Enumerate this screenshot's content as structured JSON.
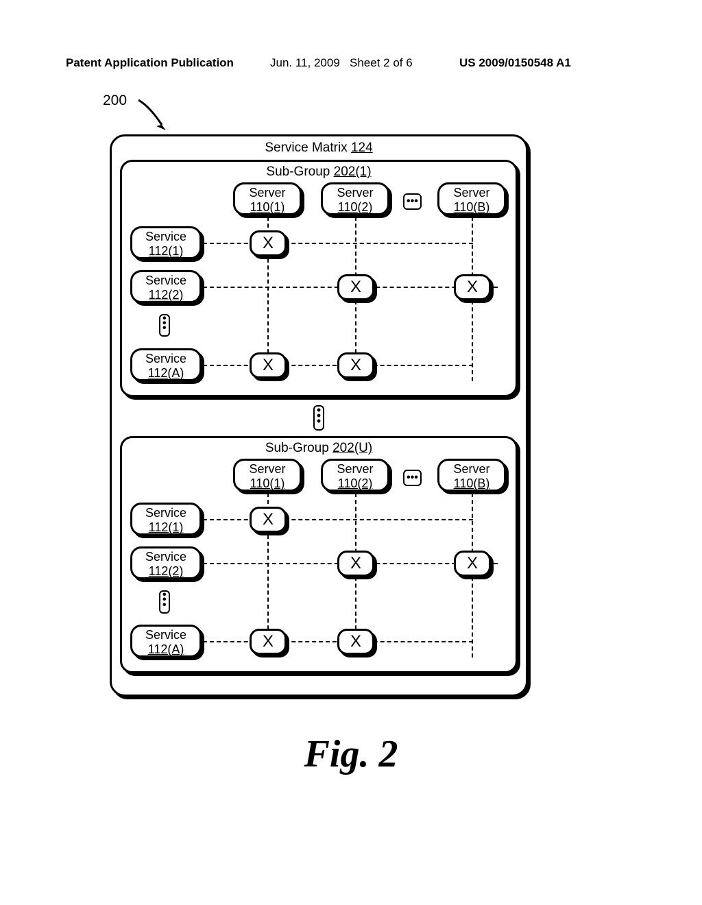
{
  "header": {
    "publication": "Patent Application Publication",
    "date": "Jun. 11, 2009",
    "sheet": "Sheet 2 of 6",
    "pubnum": "US 2009/0150548 A1"
  },
  "ref": "200",
  "matrix": {
    "title_prefix": "Service Matrix ",
    "title_num": "124"
  },
  "subgroups": [
    {
      "title_prefix": "Sub-Group ",
      "title_num": "202(1)",
      "servers": [
        {
          "label": "Server",
          "num": "110(1)"
        },
        {
          "label": "Server",
          "num": "110(2)"
        },
        {
          "label": "Server",
          "num": "110(B)"
        }
      ],
      "services": [
        {
          "label": "Service",
          "num": "112(1)"
        },
        {
          "label": "Service",
          "num": "112(2)"
        },
        {
          "label": "Service",
          "num": "112(A)"
        }
      ],
      "marks": "X",
      "matrix_cells": [
        [
          true,
          false,
          false
        ],
        [
          false,
          true,
          true
        ],
        [
          true,
          true,
          false
        ]
      ]
    },
    {
      "title_prefix": "Sub-Group ",
      "title_num": "202(U)",
      "servers": [
        {
          "label": "Server",
          "num": "110(1)"
        },
        {
          "label": "Server",
          "num": "110(2)"
        },
        {
          "label": "Server",
          "num": "110(B)"
        }
      ],
      "services": [
        {
          "label": "Service",
          "num": "112(1)"
        },
        {
          "label": "Service",
          "num": "112(2)"
        },
        {
          "label": "Service",
          "num": "112(A)"
        }
      ],
      "marks": "X",
      "matrix_cells": [
        [
          true,
          false,
          false
        ],
        [
          false,
          true,
          true
        ],
        [
          true,
          true,
          false
        ]
      ]
    }
  ],
  "figure_caption": "Fig. 2",
  "chart_data": {
    "type": "table",
    "title": "Service Matrix 124",
    "description": "Matrix mapping Services to Servers within sub-groups. X indicates the service is assigned/available on that server.",
    "subgroups": [
      {
        "name": "Sub-Group 202(1)",
        "columns": [
          "Server 110(1)",
          "Server 110(2)",
          "...",
          "Server 110(B)"
        ],
        "rows": [
          "Service 112(1)",
          "Service 112(2)",
          "...",
          "Service 112(A)"
        ],
        "cells": [
          [
            "X",
            "",
            "",
            ""
          ],
          [
            "",
            "X",
            "",
            "X"
          ],
          [
            "",
            "",
            "",
            ""
          ],
          [
            "X",
            "X",
            "",
            ""
          ]
        ]
      },
      {
        "name": "Sub-Group 202(U)",
        "columns": [
          "Server 110(1)",
          "Server 110(2)",
          "...",
          "Server 110(B)"
        ],
        "rows": [
          "Service 112(1)",
          "Service 112(2)",
          "...",
          "Service 112(A)"
        ],
        "cells": [
          [
            "X",
            "",
            "",
            ""
          ],
          [
            "",
            "X",
            "",
            "X"
          ],
          [
            "",
            "",
            "",
            ""
          ],
          [
            "X",
            "X",
            "",
            ""
          ]
        ]
      }
    ]
  }
}
